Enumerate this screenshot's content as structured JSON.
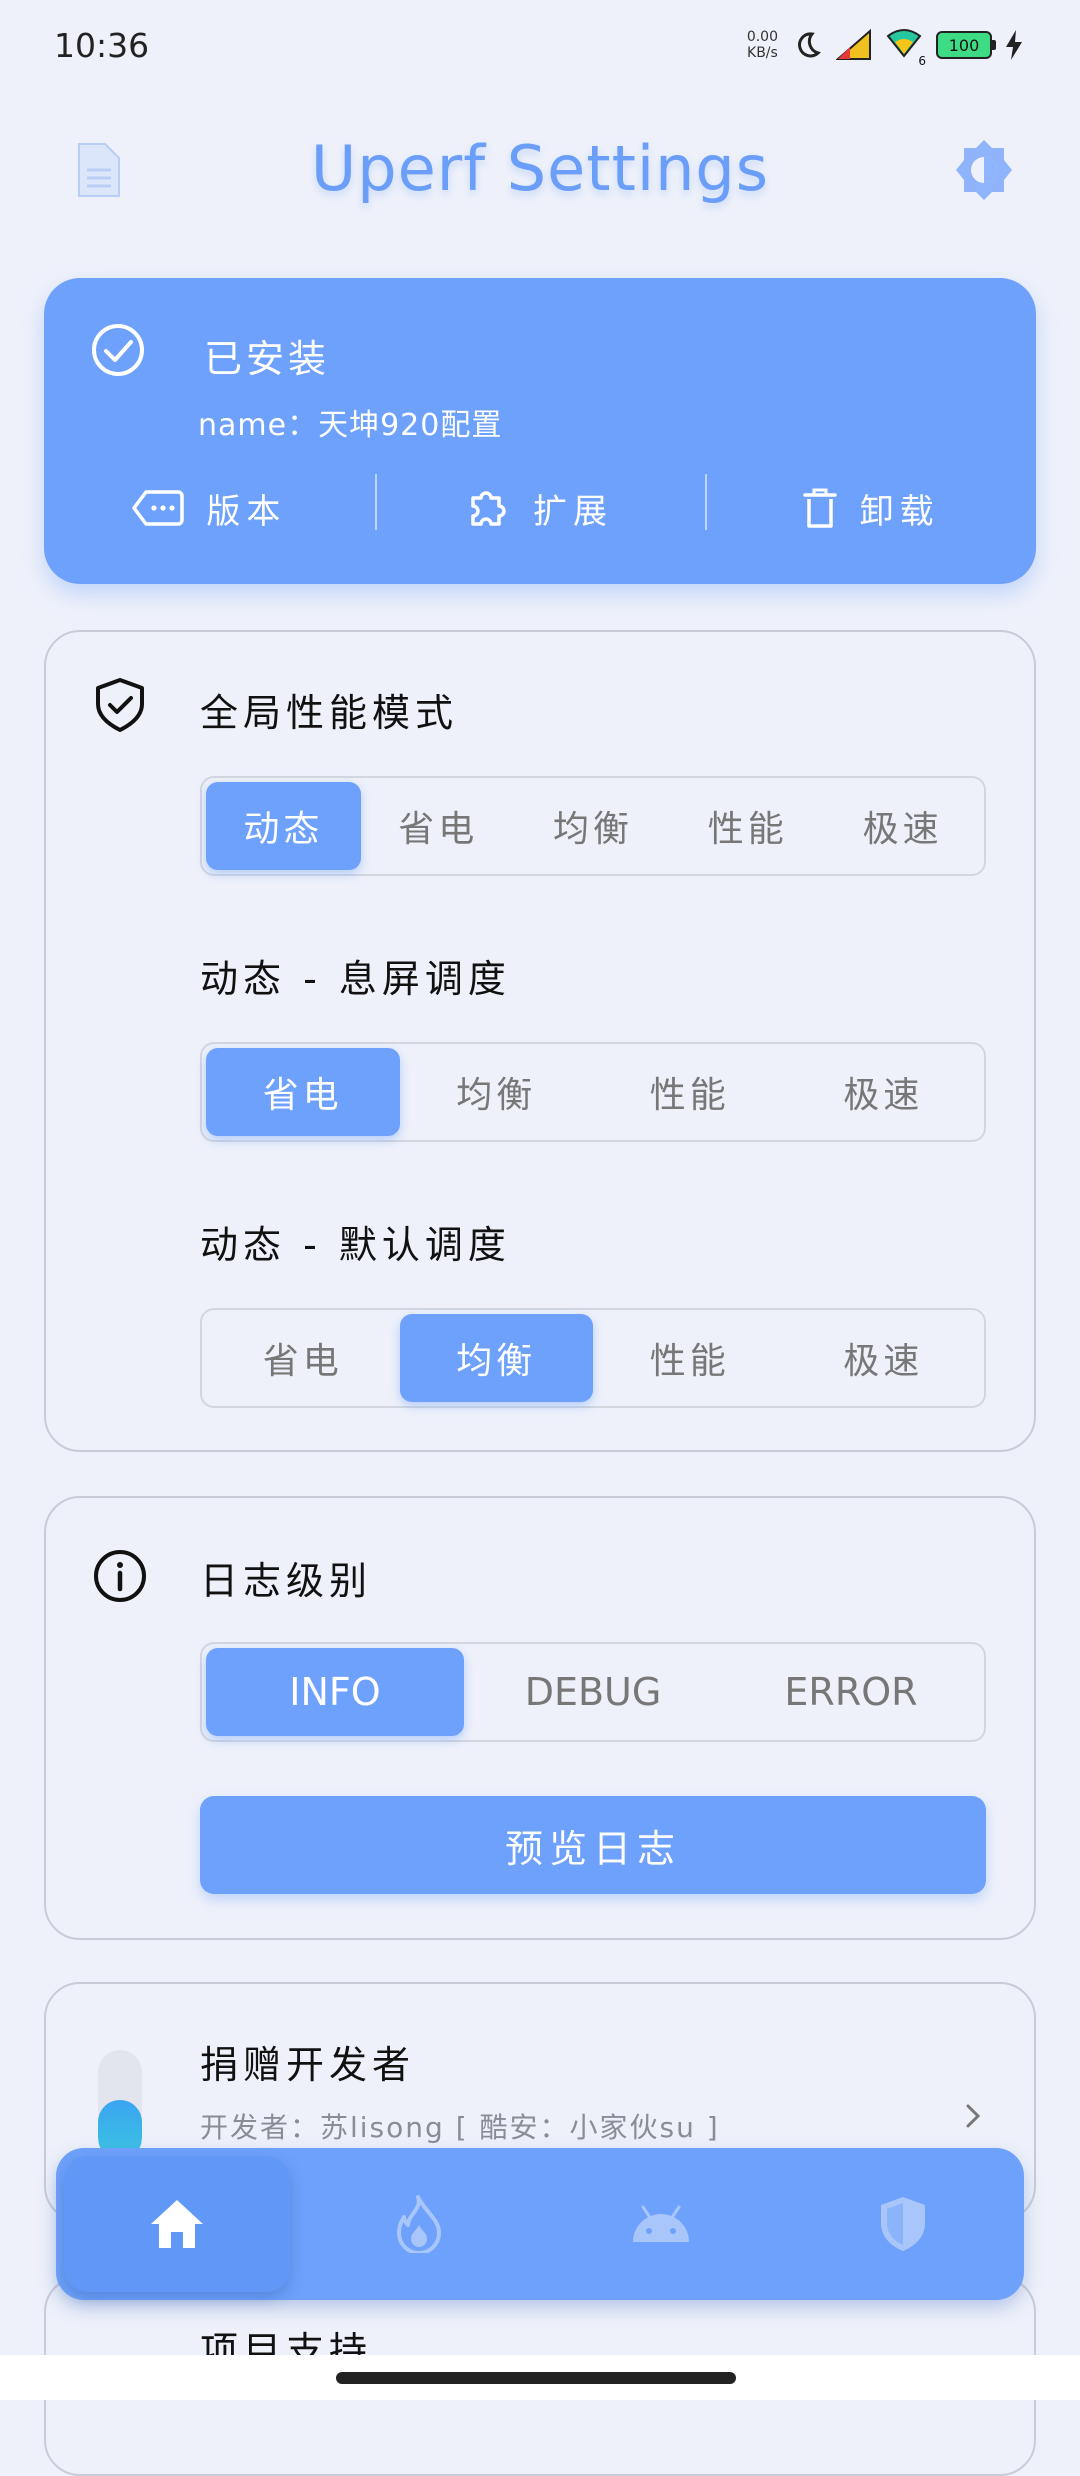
{
  "status_bar": {
    "time": "10:36",
    "net_speed_value": "0.00",
    "net_speed_unit": "KB/s",
    "battery": "100",
    "wifi_badge": "6"
  },
  "header": {
    "title": "Uperf Settings",
    "left_icon": "document-icon",
    "right_icon": "brightness-icon"
  },
  "install": {
    "status": "已安装",
    "name": "name：天坤920配置",
    "actions": [
      {
        "label": "版本",
        "icon": "tag-icon"
      },
      {
        "label": "扩展",
        "icon": "puzzle-icon"
      },
      {
        "label": "卸载",
        "icon": "trash-icon"
      }
    ]
  },
  "perf": {
    "title": "全局性能模式",
    "modes": [
      "动态",
      "省电",
      "均衡",
      "性能",
      "极速"
    ],
    "selected_mode": "动态",
    "screen_off_title": "动态 - 息屏调度",
    "screen_off_options": [
      "省电",
      "均衡",
      "性能",
      "极速"
    ],
    "screen_off_selected": "省电",
    "default_title": "动态 - 默认调度",
    "default_options": [
      "省电",
      "均衡",
      "性能",
      "极速"
    ],
    "default_selected": "均衡"
  },
  "log": {
    "title": "日志级别",
    "levels": [
      "INFO",
      "DEBUG",
      "ERROR"
    ],
    "selected": "INFO",
    "preview_label": "预览日志"
  },
  "donate": {
    "title": "捐赠开发者",
    "subtitle": "开发者：苏lisong [ 酷安：小家伙su ]"
  },
  "project": {
    "title": "项目支持"
  },
  "bottom_nav": [
    {
      "name": "home",
      "icon": "home-icon",
      "active": true
    },
    {
      "name": "flame",
      "icon": "flame-icon",
      "active": false
    },
    {
      "name": "android",
      "icon": "android-icon",
      "active": false
    },
    {
      "name": "shield",
      "icon": "shield-icon",
      "active": false
    }
  ],
  "colors": {
    "accent": "#6ea1fb",
    "background": "#eef1fa"
  }
}
